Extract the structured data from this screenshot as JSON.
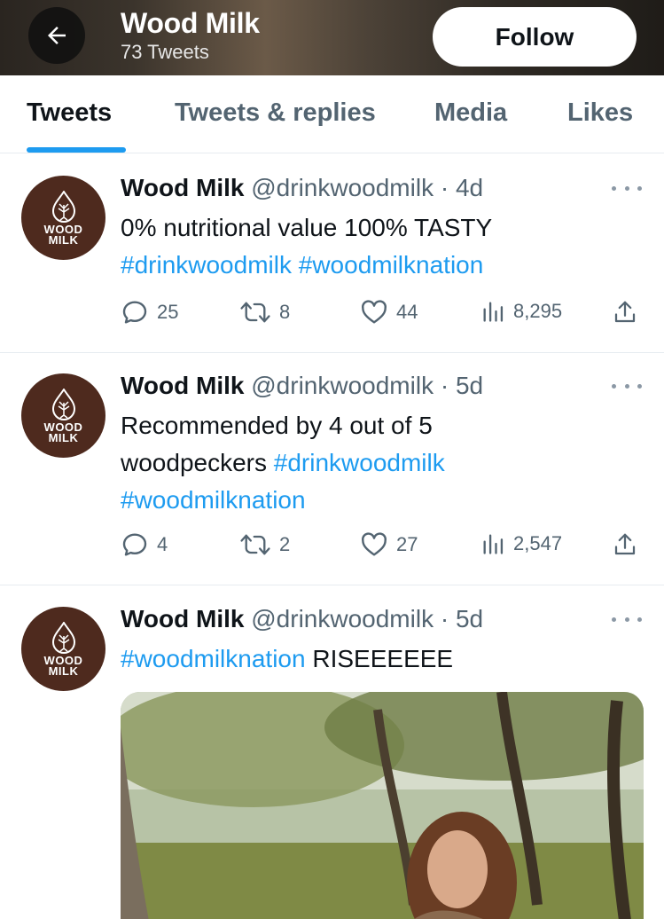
{
  "header": {
    "title": "Wood Milk",
    "subtitle": "73 Tweets",
    "follow_label": "Follow"
  },
  "tabs": [
    {
      "label": "Tweets",
      "active": true
    },
    {
      "label": "Tweets & replies",
      "active": false
    },
    {
      "label": "Media",
      "active": false
    },
    {
      "label": "Likes",
      "active": false
    }
  ],
  "brand": {
    "logo_line1": "WOOD",
    "logo_line2": "MILK",
    "avatar_color": "#4e2a1e",
    "accent": "#1d9bf0"
  },
  "tweets": [
    {
      "name": "Wood Milk",
      "handle": "@drinkwoodmilk",
      "dot": "·",
      "time": "4d",
      "text_lines": [
        {
          "plain": "0% nutritional value 100% TASTY"
        },
        {
          "tag1": "#drinkwoodmilk",
          "tag2": "#woodmilknation"
        }
      ],
      "replies": "25",
      "retweets": "8",
      "likes": "44",
      "views": "8,295"
    },
    {
      "name": "Wood Milk",
      "handle": "@drinkwoodmilk",
      "dot": "·",
      "time": "5d",
      "text_lines": [
        {
          "plain": "Recommended by 4 out of 5"
        },
        {
          "plain": "woodpeckers",
          "tag1": "#drinkwoodmilk"
        },
        {
          "tag1": "#woodmilknation"
        }
      ],
      "replies": "4",
      "retweets": "2",
      "likes": "27",
      "views": "2,547"
    },
    {
      "name": "Wood Milk",
      "handle": "@drinkwoodmilk",
      "dot": "·",
      "time": "5d",
      "text_lines": [
        {
          "tag1": "#woodmilknation",
          "plain": "RISEEEEEE"
        }
      ]
    }
  ]
}
